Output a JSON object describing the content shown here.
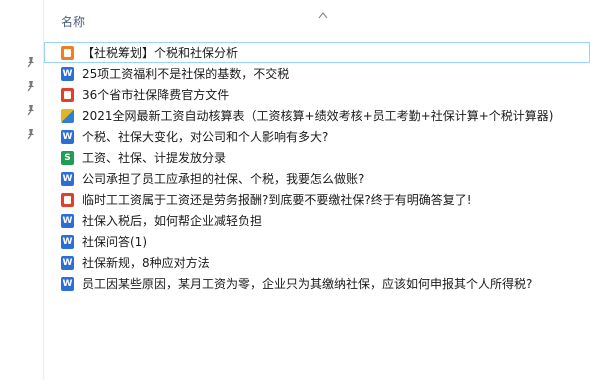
{
  "column_header": {
    "label": "名称",
    "sort": "ascending"
  },
  "files": [
    {
      "name": "【社税筹划】个税和社保分析",
      "icon": "ppt-file-icon",
      "selected": true
    },
    {
      "name": "25项工资福利不是社保的基数，不交税",
      "icon": "word-file-icon"
    },
    {
      "name": "36个省市社保降费官方文件",
      "icon": "pdf-file-icon"
    },
    {
      "name": "2021全网最新工资自动核算表（工资核算+绩效考核+员工考勤+社保计算+个税计算器)",
      "icon": "excel-macro-file-icon"
    },
    {
      "name": "个税、社保大变化，对公司和个人影响有多大?",
      "icon": "word-file-icon"
    },
    {
      "name": "工资、社保、计提发放分录",
      "icon": "excel-file-icon"
    },
    {
      "name": "公司承担了员工应承担的社保、个税，我要怎么做账?",
      "icon": "word-file-icon"
    },
    {
      "name": "临时工工资属于工资还是劳务报酬?到底要不要缴社保?终于有明确答复了!",
      "icon": "pdf-file-icon"
    },
    {
      "name": "社保入税后，如何帮企业减轻负担",
      "icon": "word-file-icon"
    },
    {
      "name": "社保问答(1)",
      "icon": "word-file-icon"
    },
    {
      "name": "社保新规，8种应对方法",
      "icon": "word-file-icon"
    },
    {
      "name": "员工因某些原因，某月工资为零，企业只为其缴纳社保，应该如何申报其个人所得税?",
      "icon": "word-file-icon"
    }
  ],
  "pinned_markers": [
    "pin-icon",
    "pin-icon",
    "pin-icon",
    "pin-icon"
  ]
}
